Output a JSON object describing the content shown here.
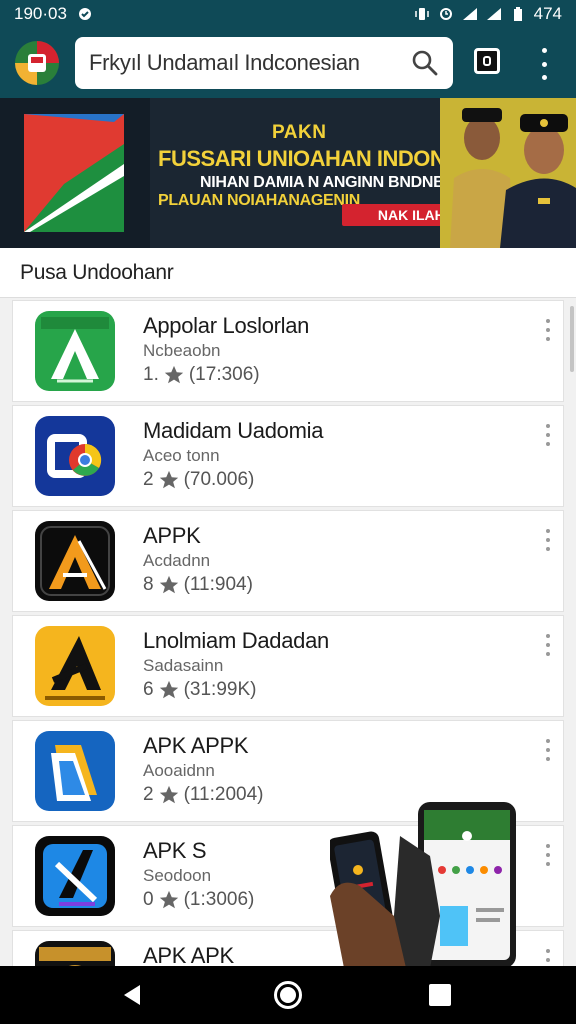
{
  "status_bar": {
    "time": "190·03",
    "battery": "474"
  },
  "search": {
    "value": "Frkyıl Undamaıl Indconesian"
  },
  "banner": {
    "line1": "PAKN",
    "line2": "FUSSARI UNIOAHAN INDONIRA",
    "line3": "NIHAN DAMIA N ANGINN BNDNBNIAT",
    "line4": "PLAUAN NOIAHANAGENIN",
    "cta": "NAK ILAHS"
  },
  "section": {
    "title": "Pusa Undoohanr"
  },
  "apps": [
    {
      "name": "Appolar Loslorlan",
      "sub": "Ncbeaobn",
      "rating": "1.",
      "count": "(17:306)",
      "icon": "a-arrow-green"
    },
    {
      "name": "Madidam Uadomia",
      "sub": "Aceo tonn",
      "rating": "2",
      "count": "(70.006)",
      "icon": "chrome-blue"
    },
    {
      "name": "APPK",
      "sub": "Acdadnn",
      "rating": "8",
      "count": "(11:904)",
      "icon": "a-orange-black"
    },
    {
      "name": "Lnolmiam Dadadan",
      "sub": "Sadasainn",
      "rating": "6",
      "count": "(31:99K)",
      "icon": "a-black-yellow"
    },
    {
      "name": "APK APPK",
      "sub": "Aooaidnn",
      "rating": "2",
      "count": "(11:2004)",
      "icon": "folder-blue"
    },
    {
      "name": "APK S",
      "sub": "Seodoon",
      "rating": "0",
      "count": "(1:3006)",
      "icon": "a-blue-black"
    },
    {
      "name": "APK APK",
      "sub": "",
      "rating": "",
      "count": "",
      "icon": "seal-gold"
    }
  ],
  "colors": {
    "app_bar": "#0f4a57",
    "banner_text": "#f2d13a",
    "cta": "#d4232f"
  }
}
